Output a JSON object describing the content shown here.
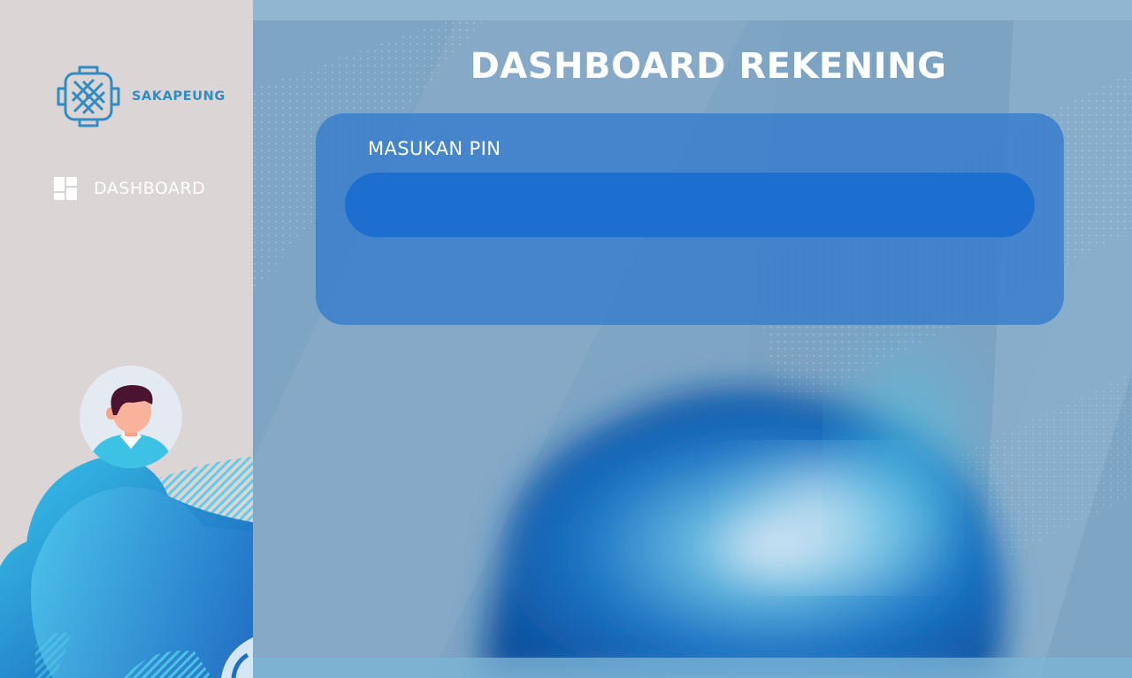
{
  "sidebar": {
    "brand_name": "SAKAPEUNG",
    "logo_icon": "sakapeung-logo",
    "nav_items": [
      {
        "label": "DASHBOARD",
        "icon": "dashboard-grid-icon"
      }
    ],
    "avatar_icon": "user-avatar"
  },
  "main": {
    "title": "DASHBOARD REKENING",
    "pin_card": {
      "label": "MASUKAN PIN",
      "input_value": "",
      "input_placeholder": ""
    }
  },
  "colors": {
    "sidebar_bg": "#dbd5d5",
    "brand": "#2f8dc4",
    "main_bg": "#7fa5c4",
    "card_bg": "#367dcd",
    "input_bg": "#1c6fcf"
  }
}
